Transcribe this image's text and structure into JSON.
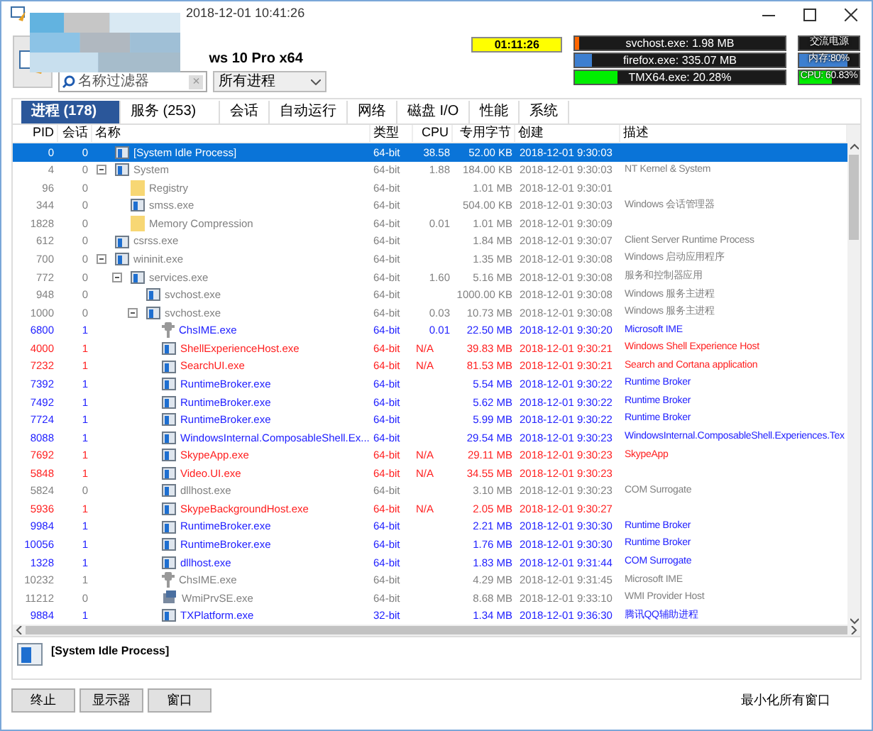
{
  "window": {
    "title": "2018-12-01 10:41:26"
  },
  "header": {
    "os": "ws 10 Pro x64",
    "filter_placeholder": "名称过滤器",
    "clear": "×",
    "scope": "所有进程",
    "timer": "01:11:26",
    "meters": [
      {
        "label": "svchost.exe: 1.98 MB",
        "level": 0.02,
        "color": "#ff6600"
      },
      {
        "label": "firefox.exe: 335.07 MB",
        "level": 0.08,
        "color": "#3d7fd0"
      },
      {
        "label": "TMX64.exe: 20.28%",
        "level": 0.2,
        "color": "#00ee00"
      }
    ],
    "status": [
      {
        "label": "交流电源"
      },
      {
        "label": "内存:80%",
        "level": 0.8,
        "color": "#3d7fd0"
      },
      {
        "label": "CPU: 60.83%",
        "level": 0.55,
        "color": "#00ee00"
      }
    ]
  },
  "tabs": [
    {
      "label": "进程 (178)",
      "selected": true
    },
    {
      "label": "服务 (253)",
      "selected": false
    },
    {
      "label": "会话",
      "selected": false
    },
    {
      "label": "自动运行",
      "selected": false
    },
    {
      "label": "网络",
      "selected": false
    },
    {
      "label": "磁盘 I/O",
      "selected": false
    },
    {
      "label": "性能",
      "selected": false
    },
    {
      "label": "系统",
      "selected": false
    }
  ],
  "table": {
    "columns": [
      "PID",
      "会话",
      "名称",
      "类型",
      "CPU",
      "专用字节",
      "创建",
      "描述"
    ],
    "rows": [
      {
        "pid": "0",
        "session": "0",
        "name": "[System Idle Process]",
        "type": "64-bit",
        "cpu": "38.58",
        "bytes": "52.00 KB",
        "created": "2018-12-01 9:30:03",
        "kind": "app",
        "selected": true
      },
      {
        "pid": "4",
        "session": "0",
        "name": "System",
        "type": "64-bit",
        "cpu": "1.88",
        "bytes": "184.00 KB",
        "created": "2018-12-01 9:30:03",
        "description": "NT Kernel & System",
        "color": "#808080",
        "kind": "app",
        "selected": false,
        "expanded": true,
        "children": [
          {
            "pid": "96",
            "session": "0",
            "name": "Registry",
            "type": "64-bit",
            "bytes": "1.01 MB",
            "created": "2018-12-01 9:30:01",
            "color": "#808080",
            "kind": "folder",
            "selected": false
          },
          {
            "pid": "344",
            "session": "0",
            "name": "smss.exe",
            "type": "64-bit",
            "bytes": "504.00 KB",
            "created": "2018-12-01 9:30:03",
            "description": "Windows 会话管理器",
            "color": "#808080",
            "kind": "app",
            "selected": false
          },
          {
            "pid": "1828",
            "session": "0",
            "name": "Memory Compression",
            "type": "64-bit",
            "cpu": "0.01",
            "bytes": "1.01 MB",
            "created": "2018-12-01 9:30:09",
            "color": "#808080",
            "kind": "folder",
            "selected": false
          }
        ]
      },
      {
        "pid": "612",
        "session": "0",
        "name": "csrss.exe",
        "type": "64-bit",
        "bytes": "1.84 MB",
        "created": "2018-12-01 9:30:07",
        "description": "Client Server Runtime Process",
        "color": "#808080",
        "kind": "app",
        "selected": false
      },
      {
        "pid": "700",
        "session": "0",
        "name": "wininit.exe",
        "type": "64-bit",
        "bytes": "1.35 MB",
        "created": "2018-12-01 9:30:08",
        "description": "Windows 启动应用程序",
        "color": "#808080",
        "kind": "app",
        "selected": false,
        "expanded": true,
        "children": [
          {
            "pid": "772",
            "session": "0",
            "name": "services.exe",
            "type": "64-bit",
            "cpu": "1.60",
            "bytes": "5.16 MB",
            "created": "2018-12-01 9:30:08",
            "description": "服务和控制器应用",
            "color": "#808080",
            "kind": "app",
            "selected": false,
            "expanded": true,
            "children": [
              {
                "pid": "948",
                "session": "0",
                "name": "svchost.exe",
                "type": "64-bit",
                "bytes": "1000.00 KB",
                "created": "2018-12-01 9:30:08",
                "description": "Windows 服务主进程",
                "color": "#808080",
                "kind": "app",
                "selected": false
              },
              {
                "pid": "1000",
                "session": "0",
                "name": "svchost.exe",
                "type": "64-bit",
                "cpu": "0.03",
                "bytes": "10.73 MB",
                "created": "2018-12-01 9:30:08",
                "description": "Windows 服务主进程",
                "color": "#808080",
                "kind": "app",
                "selected": false,
                "expanded": true,
                "children": [
                  {
                    "pid": "6800",
                    "session": "1",
                    "name": "ChsIME.exe",
                    "type": "64-bit",
                    "cpu": "0.01",
                    "bytes": "22.50 MB",
                    "created": "2018-12-01 9:30:20",
                    "description": "Microsoft IME",
                    "color": "#2020ff",
                    "kind": "ime",
                    "selected": false
                  },
                  {
                    "pid": "4000",
                    "session": "1",
                    "name": "ShellExperienceHost.exe",
                    "type": "64-bit",
                    "cpu": "N/A",
                    "bytes": "39.83 MB",
                    "created": "2018-12-01 9:30:21",
                    "description": "Windows Shell Experience Host",
                    "color": "#ff2020",
                    "kind": "app",
                    "selected": false
                  },
                  {
                    "pid": "7232",
                    "session": "1",
                    "name": "SearchUI.exe",
                    "type": "64-bit",
                    "cpu": "N/A",
                    "bytes": "81.53 MB",
                    "created": "2018-12-01 9:30:21",
                    "description": "Search and Cortana application",
                    "color": "#ff2020",
                    "kind": "app",
                    "selected": false
                  },
                  {
                    "pid": "7392",
                    "session": "1",
                    "name": "RuntimeBroker.exe",
                    "type": "64-bit",
                    "bytes": "5.54 MB",
                    "created": "2018-12-01 9:30:22",
                    "description": "Runtime Broker",
                    "color": "#2020ff",
                    "kind": "app",
                    "selected": false
                  },
                  {
                    "pid": "7492",
                    "session": "1",
                    "name": "RuntimeBroker.exe",
                    "type": "64-bit",
                    "bytes": "5.62 MB",
                    "created": "2018-12-01 9:30:22",
                    "description": "Runtime Broker",
                    "color": "#2020ff",
                    "kind": "app",
                    "selected": false
                  },
                  {
                    "pid": "7724",
                    "session": "1",
                    "name": "RuntimeBroker.exe",
                    "type": "64-bit",
                    "bytes": "5.99 MB",
                    "created": "2018-12-01 9:30:22",
                    "description": "Runtime Broker",
                    "color": "#2020ff",
                    "kind": "app",
                    "selected": false
                  },
                  {
                    "pid": "8088",
                    "session": "1",
                    "name": "WindowsInternal.ComposableShell.Ex...",
                    "type": "64-bit",
                    "bytes": "29.54 MB",
                    "created": "2018-12-01 9:30:23",
                    "description": "WindowsInternal.ComposableShell.Experiences.Tex",
                    "color": "#2020ff",
                    "kind": "app",
                    "selected": false
                  },
                  {
                    "pid": "7692",
                    "session": "1",
                    "name": "SkypeApp.exe",
                    "type": "64-bit",
                    "cpu": "N/A",
                    "bytes": "29.11 MB",
                    "created": "2018-12-01 9:30:23",
                    "description": "SkypeApp",
                    "color": "#ff2020",
                    "kind": "app",
                    "selected": false
                  },
                  {
                    "pid": "5848",
                    "session": "1",
                    "name": "Video.UI.exe",
                    "type": "64-bit",
                    "cpu": "N/A",
                    "bytes": "34.55 MB",
                    "created": "2018-12-01 9:30:23",
                    "color": "#ff2020",
                    "kind": "app",
                    "selected": false
                  },
                  {
                    "pid": "5824",
                    "session": "0",
                    "name": "dllhost.exe",
                    "type": "64-bit",
                    "bytes": "3.10 MB",
                    "created": "2018-12-01 9:30:23",
                    "description": "COM Surrogate",
                    "color": "#808080",
                    "kind": "app",
                    "selected": false
                  },
                  {
                    "pid": "5936",
                    "session": "1",
                    "name": "SkypeBackgroundHost.exe",
                    "type": "64-bit",
                    "cpu": "N/A",
                    "bytes": "2.05 MB",
                    "created": "2018-12-01 9:30:27",
                    "color": "#ff2020",
                    "kind": "app",
                    "selected": false
                  },
                  {
                    "pid": "9984",
                    "session": "1",
                    "name": "RuntimeBroker.exe",
                    "type": "64-bit",
                    "bytes": "2.21 MB",
                    "created": "2018-12-01 9:30:30",
                    "description": "Runtime Broker",
                    "color": "#2020ff",
                    "kind": "app",
                    "selected": false
                  },
                  {
                    "pid": "10056",
                    "session": "1",
                    "name": "RuntimeBroker.exe",
                    "type": "64-bit",
                    "bytes": "1.76 MB",
                    "created": "2018-12-01 9:30:30",
                    "description": "Runtime Broker",
                    "color": "#2020ff",
                    "kind": "app",
                    "selected": false
                  },
                  {
                    "pid": "1328",
                    "session": "1",
                    "name": "dllhost.exe",
                    "type": "64-bit",
                    "bytes": "1.83 MB",
                    "created": "2018-12-01 9:31:44",
                    "description": "COM Surrogate",
                    "color": "#2020ff",
                    "kind": "app",
                    "selected": false
                  },
                  {
                    "pid": "10232",
                    "session": "1",
                    "name": "ChsIME.exe",
                    "type": "64-bit",
                    "bytes": "4.29 MB",
                    "created": "2018-12-01 9:31:45",
                    "description": "Microsoft IME",
                    "color": "#808080",
                    "kind": "ime",
                    "selected": false
                  },
                  {
                    "pid": "11212",
                    "session": "0",
                    "name": "WmiPrvSE.exe",
                    "type": "64-bit",
                    "bytes": "8.68 MB",
                    "created": "2018-12-01 9:33:10",
                    "description": "WMI Provider Host",
                    "color": "#808080",
                    "kind": "wmi",
                    "selected": false
                  },
                  {
                    "pid": "9884",
                    "session": "1",
                    "name": "TXPlatform.exe",
                    "type": "32-bit",
                    "bytes": "1.34 MB",
                    "created": "2018-12-01 9:36:30",
                    "description": "腾讯QQ辅助进程",
                    "color": "#2020ff",
                    "kind": "app",
                    "selected": false
                  }
                ]
              }
            ]
          }
        ]
      }
    ]
  },
  "detail": {
    "name": "[System Idle Process]"
  },
  "buttons": [
    "终止",
    "显示器",
    "窗口"
  ],
  "right_button": "最小化所有窗口"
}
